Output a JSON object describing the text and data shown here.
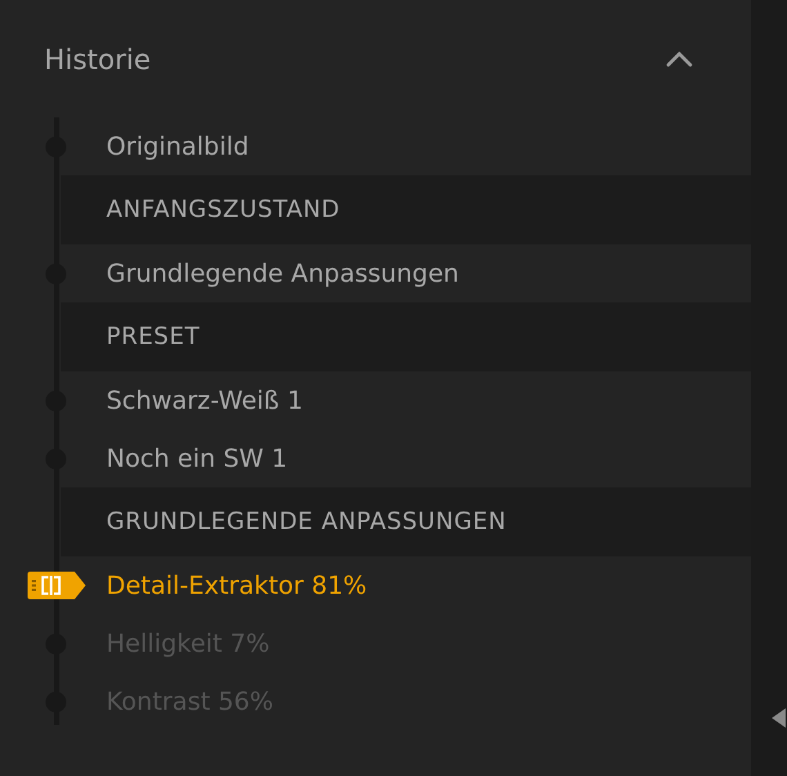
{
  "panel": {
    "title": "Historie",
    "expanded": true
  },
  "history": [
    {
      "kind": "step",
      "label": "Originalbild",
      "current": false,
      "dimmed": false
    },
    {
      "kind": "group",
      "label": "ANFANGSZUSTAND"
    },
    {
      "kind": "step",
      "label": "Grundlegende Anpassungen",
      "current": false,
      "dimmed": false
    },
    {
      "kind": "group",
      "label": "PRESET"
    },
    {
      "kind": "step",
      "label": "Schwarz-Weiß 1",
      "current": false,
      "dimmed": false
    },
    {
      "kind": "step",
      "label": "Noch ein SW 1",
      "current": false,
      "dimmed": false
    },
    {
      "kind": "group",
      "label": "GRUNDLEGENDE ANPASSUNGEN"
    },
    {
      "kind": "step",
      "label": "Detail-Extraktor 81%",
      "current": true,
      "dimmed": false
    },
    {
      "kind": "step",
      "label": "Helligkeit 7%",
      "current": false,
      "dimmed": true
    },
    {
      "kind": "step",
      "label": "Kontrast 56%",
      "current": false,
      "dimmed": true
    }
  ]
}
